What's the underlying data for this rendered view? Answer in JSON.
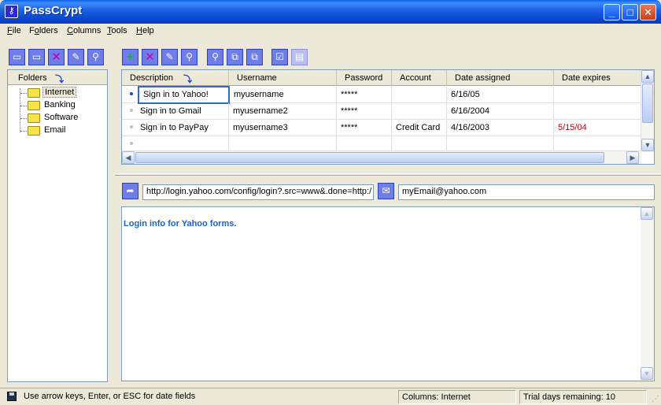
{
  "window": {
    "title": "PassCrypt",
    "minimize": "_",
    "maximize": "□",
    "close": "✕"
  },
  "menu": [
    {
      "prefix": "",
      "accel": "F",
      "rest": "ile"
    },
    {
      "prefix": "F",
      "accel": "o",
      "rest": "lders"
    },
    {
      "prefix": "",
      "accel": "C",
      "rest": "olumns"
    },
    {
      "prefix": "",
      "accel": "T",
      "rest": "ools"
    },
    {
      "prefix": "",
      "accel": "H",
      "rest": "elp"
    }
  ],
  "folders": {
    "header": "Folders",
    "items": [
      {
        "label": "Internet",
        "selected": true
      },
      {
        "label": "Banking",
        "selected": false
      },
      {
        "label": "Software",
        "selected": false
      },
      {
        "label": "Email",
        "selected": false
      }
    ]
  },
  "grid": {
    "columns": [
      "Description",
      "Username",
      "Password",
      "Account",
      "Date assigned",
      "Date expires"
    ],
    "rows": [
      {
        "description": "Sign in to Yahoo!",
        "username": "myusername",
        "password": "*****",
        "account": "",
        "date_assigned": "6/16/05",
        "date_expires": "",
        "active": true
      },
      {
        "description": "Sign in to Gmail",
        "username": "myusername2",
        "password": "*****",
        "account": "",
        "date_assigned": "6/16/2004",
        "date_expires": "",
        "active": false
      },
      {
        "description": "Sign in to PayPay",
        "username": "myusername3",
        "password": "*****",
        "account": "Credit Card",
        "date_assigned": "4/16/2003",
        "date_expires": "5/15/04",
        "active": false
      },
      {
        "description": "",
        "username": "",
        "password": "",
        "account": "",
        "date_assigned": "",
        "date_expires": "",
        "active": false
      }
    ]
  },
  "url_field": {
    "value": "http://login.yahoo.com/config/login?.src=www&.done=http:/"
  },
  "email_field": {
    "value": "myEmail@yahoo.com"
  },
  "notes": {
    "text": "Login info for Yahoo forms."
  },
  "status": {
    "hint": "Use arrow keys, Enter, or ESC for date fields",
    "columns": "Columns: Internet",
    "trial": "Trial days remaining: 10"
  },
  "colors": {
    "titlebar": "#0a46cf",
    "expired": "#c00000",
    "notes_text": "#1a62c8",
    "selection": "#316ac5"
  }
}
